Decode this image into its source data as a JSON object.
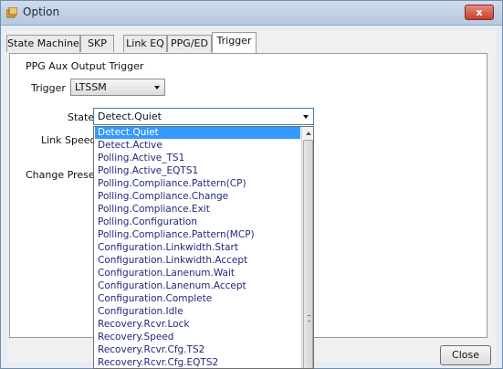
{
  "window": {
    "title": "Option",
    "close_glyph": "x"
  },
  "tabs": [
    {
      "label": "State Machine"
    },
    {
      "label": "SKP"
    },
    {
      "label": "Link EQ"
    },
    {
      "label": "PPG/ED"
    },
    {
      "label": "Trigger",
      "active": true
    }
  ],
  "panel": {
    "section_title": "PPG Aux Output Trigger",
    "trigger_label": "Trigger",
    "trigger_value": "LTSSM",
    "state_label": "State",
    "state_value": "Detect.Quiet",
    "link_speed_label": "Link Speed",
    "change_preset_label": "Change Preset"
  },
  "dropdown": {
    "selected": "Detect.Quiet",
    "items": [
      "Detect.Quiet",
      "Detect.Active",
      "Polling.Active_TS1",
      "Polling.Active_EQTS1",
      "Polling.Compliance.Pattern(CP)",
      "Polling.Compliance.Change",
      "Polling.Compliance.Exit",
      "Polling.Configuration",
      "Polling.Compliance.Pattern(MCP)",
      "Configuration.Linkwidth.Start",
      "Configuration.Linkwidth.Accept",
      "Configuration.Lanenum.Wait",
      "Configuration.Lanenum.Accept",
      "Configuration.Complete",
      "Configuration.Idle",
      "Recovery.Rcvr.Lock",
      "Recovery.Speed",
      "Recovery.Rcvr.Cfg.TS2",
      "Recovery.Rcvr.Cfg.EQTS2"
    ]
  },
  "footer": {
    "close_label": "Close"
  },
  "icons": {
    "app": "option-app-icon",
    "close": "close-icon",
    "dropdown": "chevron-down-icon",
    "scroll_up": "arrow-up-icon"
  },
  "colors": {
    "highlight": "#3399ff",
    "item_text": "#1f2a7a",
    "titlebar": "#c3d3e6"
  }
}
